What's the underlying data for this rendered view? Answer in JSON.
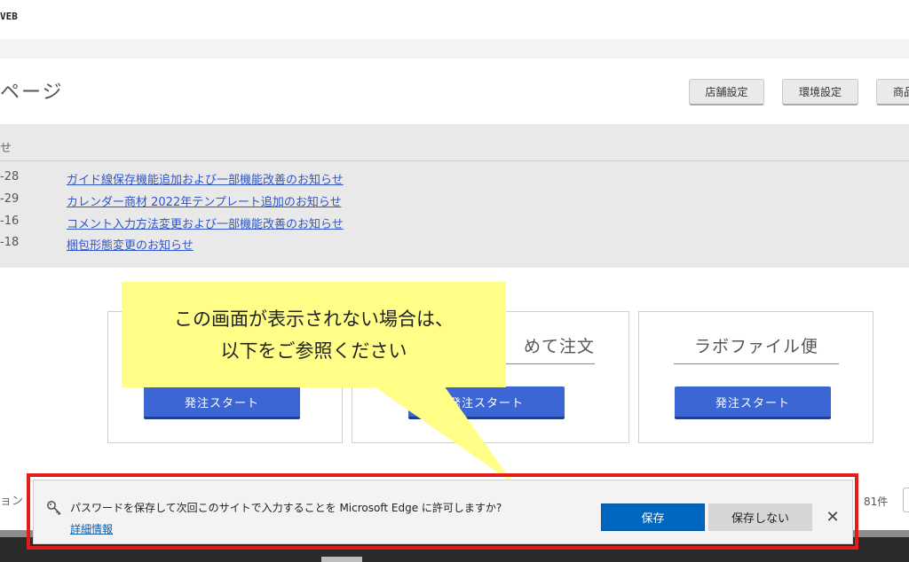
{
  "header": {
    "logo": "VEB",
    "page_title": "ページ",
    "buttons": [
      "店舗設定",
      "環境設定",
      "商品"
    ]
  },
  "notices": {
    "heading": "せ",
    "items": [
      {
        "date": "-28",
        "title": "ガイド線保存機能追加および一部機能改善のお知らせ"
      },
      {
        "date": "-29",
        "title": "カレンダー商材 2022年テンプレート追加のお知らせ"
      },
      {
        "date": "-16",
        "title": "コメント入力方法変更および一部機能改善のお知らせ"
      },
      {
        "date": "-18",
        "title": "梱包形態変更のお知らせ"
      }
    ]
  },
  "cards": [
    {
      "title": "",
      "button": "発注スタート"
    },
    {
      "title": "めて注文",
      "button": "発注スタート"
    },
    {
      "title": "ラボファイル便",
      "button": "発注スタート"
    }
  ],
  "callout": {
    "line1": "この画面が表示されない場合は、",
    "line2": "以下をご参照ください"
  },
  "footer": {
    "left_text": "ョン",
    "count": "81件"
  },
  "edge_prompt": {
    "message": "パスワードを保存して次回このサイトで入力することを Microsoft Edge に許可しますか?",
    "details_link": "詳細情報",
    "save_label": "保存",
    "no_save_label": "保存しない",
    "close_glyph": "✕"
  },
  "colors": {
    "accent_blue": "#3b66d4",
    "edge_blue": "#0067c0",
    "callout_yellow": "#ffff88",
    "highlight_red": "#e31b1b",
    "link_blue": "#2f56c8"
  }
}
